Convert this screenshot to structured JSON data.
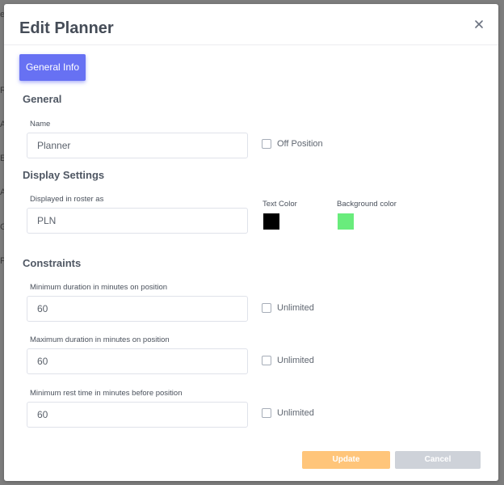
{
  "backdrop": {
    "letters": [
      "e",
      "R",
      "A",
      "E",
      "A",
      "G",
      "P"
    ]
  },
  "modal": {
    "title": "Edit Planner",
    "tabs": [
      {
        "label": "General Info",
        "active": true
      }
    ],
    "general": {
      "section_title": "General",
      "name_label": "Name",
      "name_value": "Planner",
      "off_position_label": "Off Position",
      "off_position_checked": false
    },
    "display": {
      "section_title": "Display Settings",
      "roster_label": "Displayed in roster as",
      "roster_value": "PLN",
      "text_color_label": "Text Color",
      "text_color": "#000000",
      "bg_color_label": "Background color",
      "bg_color": "#69ec7c"
    },
    "constraints": {
      "section_title": "Constraints",
      "min_duration_label": "Minimum duration in minutes on position",
      "min_duration_value": "60",
      "max_duration_label": "Maximum duration in minutes on position",
      "max_duration_value": "60",
      "min_rest_label": "Minimum rest time in minutes before position",
      "min_rest_value": "60",
      "unlimited_label": "Unlimited"
    },
    "buttons": {
      "update": "Update",
      "cancel": "Cancel"
    }
  },
  "colors": {
    "accent": "#6771f3",
    "update_button": "#ffc57a",
    "cancel_button": "#ced2d9"
  },
  "icons": {
    "close": "close-icon"
  }
}
